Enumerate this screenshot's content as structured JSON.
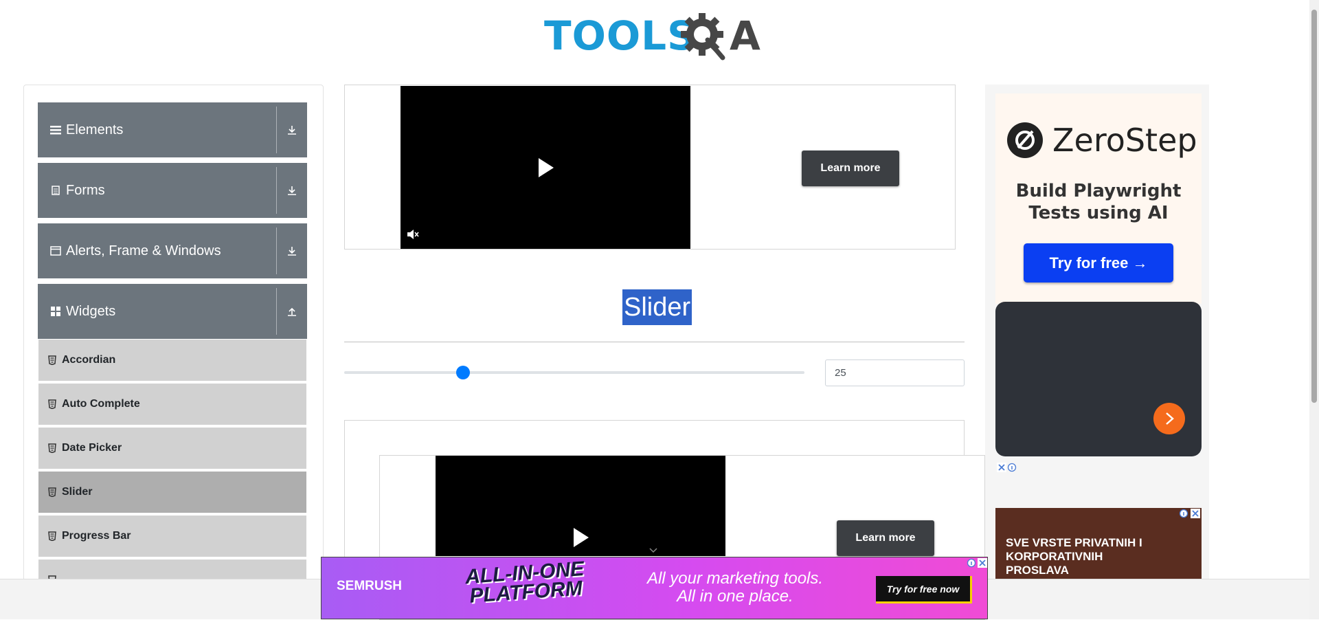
{
  "header": {
    "logo_text": "TOOLS",
    "logo_letter": "A"
  },
  "sidebar": {
    "groups": [
      {
        "label": "Elements",
        "icon": "hamburger-icon",
        "toggle": "download-icon"
      },
      {
        "label": "Forms",
        "icon": "document-icon",
        "toggle": "download-icon"
      },
      {
        "label": "Alerts, Frame & Windows",
        "icon": "window-icon",
        "toggle": "download-icon"
      },
      {
        "label": "Widgets",
        "icon": "widgets-icon",
        "toggle": "upload-icon"
      }
    ],
    "items": [
      {
        "label": "Accordian"
      },
      {
        "label": "Auto Complete"
      },
      {
        "label": "Date Picker"
      },
      {
        "label": "Slider",
        "active": true
      },
      {
        "label": "Progress Bar"
      }
    ]
  },
  "video_ad_top": {
    "cta": "Learn more"
  },
  "video_ad_bottom": {
    "cta": "Learn more"
  },
  "main": {
    "title": "Slider",
    "slider": {
      "min": 0,
      "max": 100,
      "value": 25,
      "value_text": "25",
      "accent": "#007bff"
    }
  },
  "right_ad": {
    "brand": "ZeroStep",
    "tagline_line1": "Build Playwright",
    "tagline_line2": "Tests using AI",
    "cta": "Try for free →",
    "bar_ad_text": "SVE VRSTE PRIVATNIH I KORPORATIVNIH PROSLAVA"
  },
  "bottom_banner": {
    "brand": "SEMRUSH",
    "badge_line1": "ALL-IN-ONE",
    "badge_line2": "PLATFORM",
    "tagline_line1": "All your marketing tools.",
    "tagline_line2": "All in one place.",
    "cta": "Try for free now"
  },
  "colors": {
    "sidebar_header": "#6c757d",
    "menu_item": "#d1d1d1",
    "menu_item_active": "#aeaeae",
    "title_highlight": "#2f63c9",
    "brand_blue": "#1b9ad6"
  }
}
